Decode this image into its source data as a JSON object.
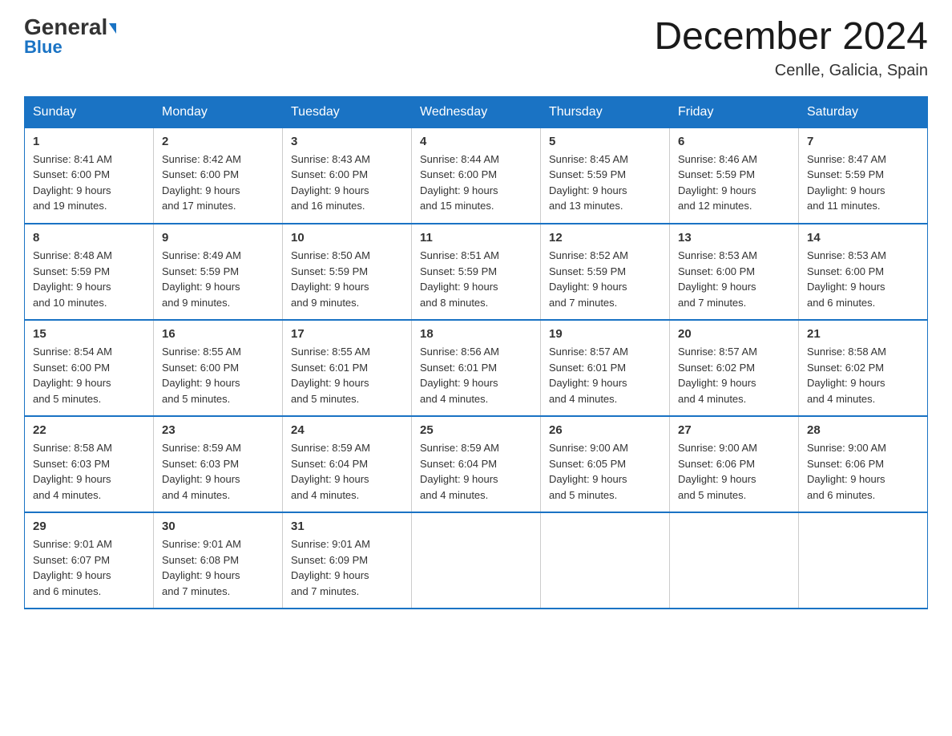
{
  "logo": {
    "general": "General",
    "blue": "Blue"
  },
  "title": "December 2024",
  "location": "Cenlle, Galicia, Spain",
  "weekdays": [
    "Sunday",
    "Monday",
    "Tuesday",
    "Wednesday",
    "Thursday",
    "Friday",
    "Saturday"
  ],
  "weeks": [
    [
      {
        "num": "1",
        "sunrise": "8:41 AM",
        "sunset": "6:00 PM",
        "daylight": "9 hours and 19 minutes."
      },
      {
        "num": "2",
        "sunrise": "8:42 AM",
        "sunset": "6:00 PM",
        "daylight": "9 hours and 17 minutes."
      },
      {
        "num": "3",
        "sunrise": "8:43 AM",
        "sunset": "6:00 PM",
        "daylight": "9 hours and 16 minutes."
      },
      {
        "num": "4",
        "sunrise": "8:44 AM",
        "sunset": "6:00 PM",
        "daylight": "9 hours and 15 minutes."
      },
      {
        "num": "5",
        "sunrise": "8:45 AM",
        "sunset": "5:59 PM",
        "daylight": "9 hours and 13 minutes."
      },
      {
        "num": "6",
        "sunrise": "8:46 AM",
        "sunset": "5:59 PM",
        "daylight": "9 hours and 12 minutes."
      },
      {
        "num": "7",
        "sunrise": "8:47 AM",
        "sunset": "5:59 PM",
        "daylight": "9 hours and 11 minutes."
      }
    ],
    [
      {
        "num": "8",
        "sunrise": "8:48 AM",
        "sunset": "5:59 PM",
        "daylight": "9 hours and 10 minutes."
      },
      {
        "num": "9",
        "sunrise": "8:49 AM",
        "sunset": "5:59 PM",
        "daylight": "9 hours and 9 minutes."
      },
      {
        "num": "10",
        "sunrise": "8:50 AM",
        "sunset": "5:59 PM",
        "daylight": "9 hours and 9 minutes."
      },
      {
        "num": "11",
        "sunrise": "8:51 AM",
        "sunset": "5:59 PM",
        "daylight": "9 hours and 8 minutes."
      },
      {
        "num": "12",
        "sunrise": "8:52 AM",
        "sunset": "5:59 PM",
        "daylight": "9 hours and 7 minutes."
      },
      {
        "num": "13",
        "sunrise": "8:53 AM",
        "sunset": "6:00 PM",
        "daylight": "9 hours and 7 minutes."
      },
      {
        "num": "14",
        "sunrise": "8:53 AM",
        "sunset": "6:00 PM",
        "daylight": "9 hours and 6 minutes."
      }
    ],
    [
      {
        "num": "15",
        "sunrise": "8:54 AM",
        "sunset": "6:00 PM",
        "daylight": "9 hours and 5 minutes."
      },
      {
        "num": "16",
        "sunrise": "8:55 AM",
        "sunset": "6:00 PM",
        "daylight": "9 hours and 5 minutes."
      },
      {
        "num": "17",
        "sunrise": "8:55 AM",
        "sunset": "6:01 PM",
        "daylight": "9 hours and 5 minutes."
      },
      {
        "num": "18",
        "sunrise": "8:56 AM",
        "sunset": "6:01 PM",
        "daylight": "9 hours and 4 minutes."
      },
      {
        "num": "19",
        "sunrise": "8:57 AM",
        "sunset": "6:01 PM",
        "daylight": "9 hours and 4 minutes."
      },
      {
        "num": "20",
        "sunrise": "8:57 AM",
        "sunset": "6:02 PM",
        "daylight": "9 hours and 4 minutes."
      },
      {
        "num": "21",
        "sunrise": "8:58 AM",
        "sunset": "6:02 PM",
        "daylight": "9 hours and 4 minutes."
      }
    ],
    [
      {
        "num": "22",
        "sunrise": "8:58 AM",
        "sunset": "6:03 PM",
        "daylight": "9 hours and 4 minutes."
      },
      {
        "num": "23",
        "sunrise": "8:59 AM",
        "sunset": "6:03 PM",
        "daylight": "9 hours and 4 minutes."
      },
      {
        "num": "24",
        "sunrise": "8:59 AM",
        "sunset": "6:04 PM",
        "daylight": "9 hours and 4 minutes."
      },
      {
        "num": "25",
        "sunrise": "8:59 AM",
        "sunset": "6:04 PM",
        "daylight": "9 hours and 4 minutes."
      },
      {
        "num": "26",
        "sunrise": "9:00 AM",
        "sunset": "6:05 PM",
        "daylight": "9 hours and 5 minutes."
      },
      {
        "num": "27",
        "sunrise": "9:00 AM",
        "sunset": "6:06 PM",
        "daylight": "9 hours and 5 minutes."
      },
      {
        "num": "28",
        "sunrise": "9:00 AM",
        "sunset": "6:06 PM",
        "daylight": "9 hours and 6 minutes."
      }
    ],
    [
      {
        "num": "29",
        "sunrise": "9:01 AM",
        "sunset": "6:07 PM",
        "daylight": "9 hours and 6 minutes."
      },
      {
        "num": "30",
        "sunrise": "9:01 AM",
        "sunset": "6:08 PM",
        "daylight": "9 hours and 7 minutes."
      },
      {
        "num": "31",
        "sunrise": "9:01 AM",
        "sunset": "6:09 PM",
        "daylight": "9 hours and 7 minutes."
      },
      null,
      null,
      null,
      null
    ]
  ],
  "labels": {
    "sunrise": "Sunrise:",
    "sunset": "Sunset:",
    "daylight": "Daylight:"
  }
}
